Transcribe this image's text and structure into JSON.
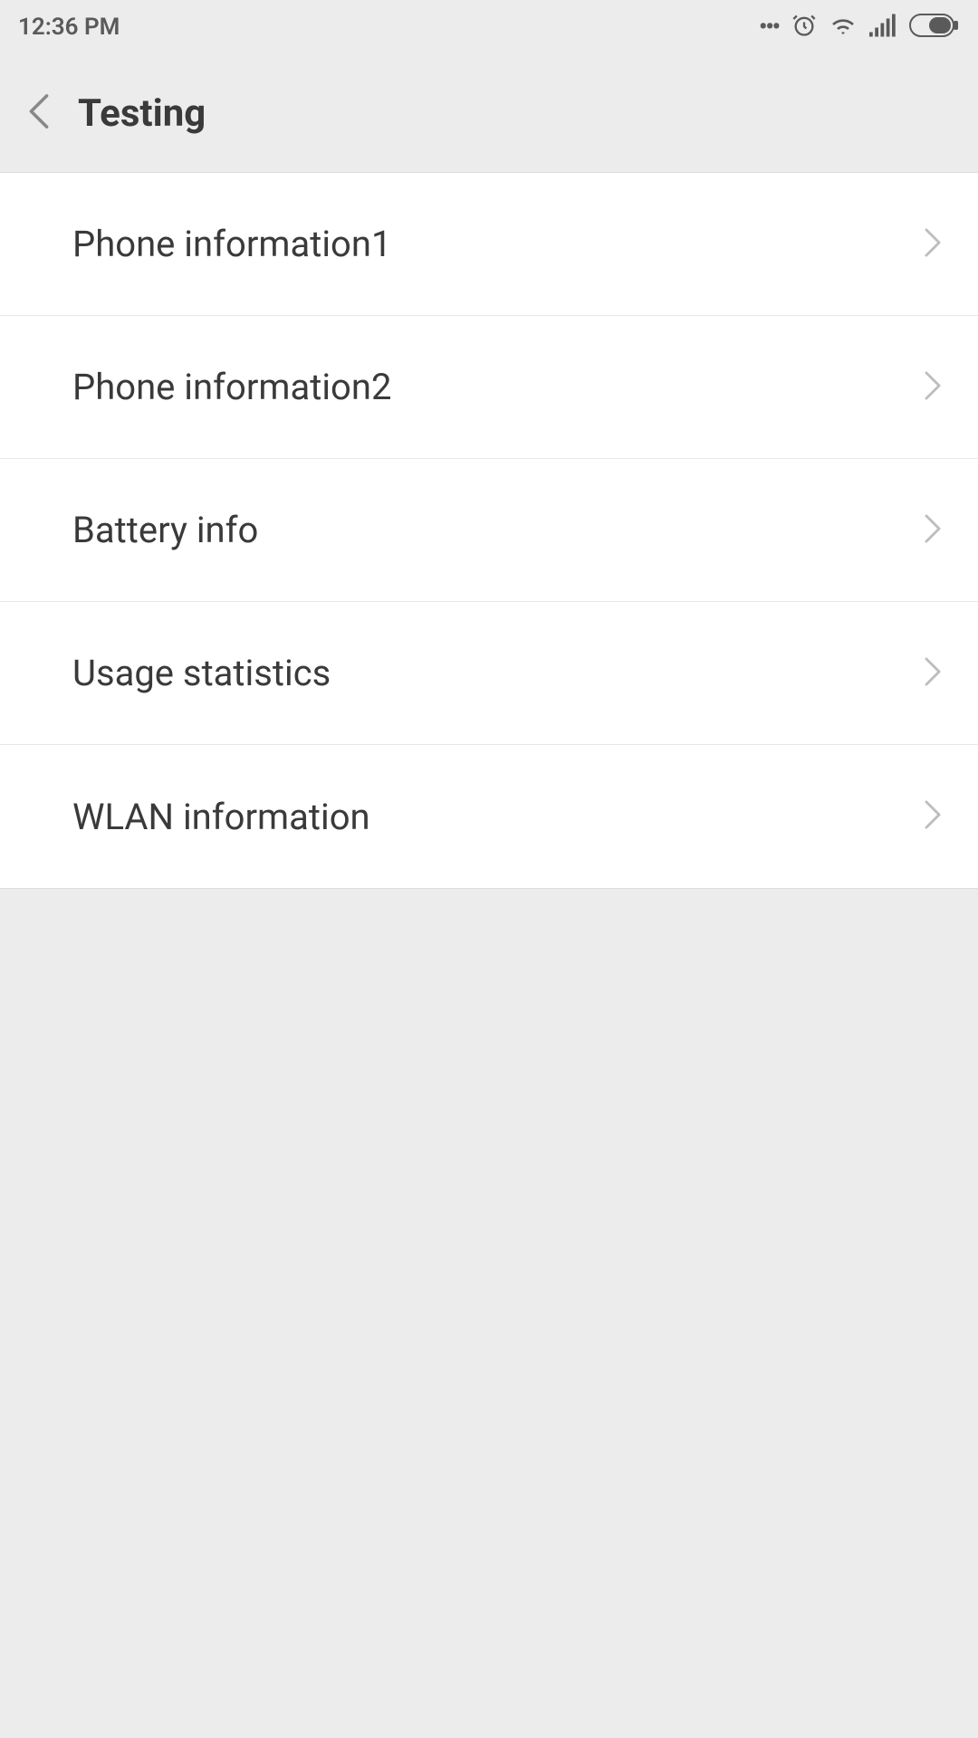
{
  "status": {
    "time": "12:36 PM"
  },
  "header": {
    "title": "Testing"
  },
  "menu": {
    "items": [
      {
        "label": "Phone information1"
      },
      {
        "label": "Phone information2"
      },
      {
        "label": "Battery info"
      },
      {
        "label": "Usage statistics"
      },
      {
        "label": "WLAN information"
      }
    ]
  }
}
